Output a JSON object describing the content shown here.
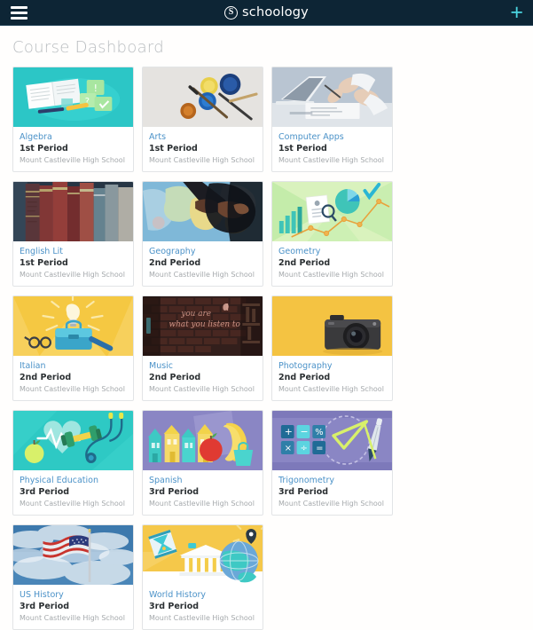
{
  "header": {
    "menu_icon": "hamburger-icon",
    "logo_mark": "S",
    "logo_text": "schoology",
    "add_icon": "plus-icon",
    "bg_color": "#0d2535",
    "accent_color": "#4ad4e0"
  },
  "page": {
    "title": "Course Dashboard",
    "background": "#fffefd"
  },
  "courses": [
    {
      "name": "Algebra",
      "period": "1st Period",
      "school": "Mount Castleville High School",
      "thumb": "algebra-notebook-illustration"
    },
    {
      "name": "Arts",
      "period": "1st Period",
      "school": "Mount Castleville High School",
      "thumb": "arts-paint-photo"
    },
    {
      "name": "Computer Apps",
      "period": "1st Period",
      "school": "Mount Castleville High School",
      "thumb": "computer-apps-laptop-photo"
    },
    {
      "name": "English Lit",
      "period": "1st Period",
      "school": "Mount Castleville High School",
      "thumb": "english-lit-books-photo"
    },
    {
      "name": "Geography",
      "period": "2nd Period",
      "school": "Mount Castleville High School",
      "thumb": "geography-map-photo"
    },
    {
      "name": "Geometry",
      "period": "2nd Period",
      "school": "Mount Castleville High School",
      "thumb": "geometry-charts-illustration"
    },
    {
      "name": "Italian",
      "period": "2nd Period",
      "school": "Mount Castleville High School",
      "thumb": "italian-lightbulb-illustration"
    },
    {
      "name": "Music",
      "period": "2nd Period",
      "school": "Mount Castleville High School",
      "thumb": "music-neon-brick-photo"
    },
    {
      "name": "Photography",
      "period": "2nd Period",
      "school": "Mount Castleville High School",
      "thumb": "photography-camera-photo"
    },
    {
      "name": "Physical Education",
      "period": "3rd Period",
      "school": "Mount Castleville High School",
      "thumb": "pe-heart-dumbbell-illustration"
    },
    {
      "name": "Spanish",
      "period": "3rd Period",
      "school": "Mount Castleville High School",
      "thumb": "spanish-houses-illustration"
    },
    {
      "name": "Trigonometry",
      "period": "3rd Period",
      "school": "Mount Castleville High School",
      "thumb": "trigonometry-calculator-illustration"
    },
    {
      "name": "US History",
      "period": "3rd Period",
      "school": "Mount Castleville High School",
      "thumb": "us-history-flag-photo"
    },
    {
      "name": "World History",
      "period": "3rd Period",
      "school": "Mount Castleville High School",
      "thumb": "world-history-globe-illustration"
    }
  ]
}
